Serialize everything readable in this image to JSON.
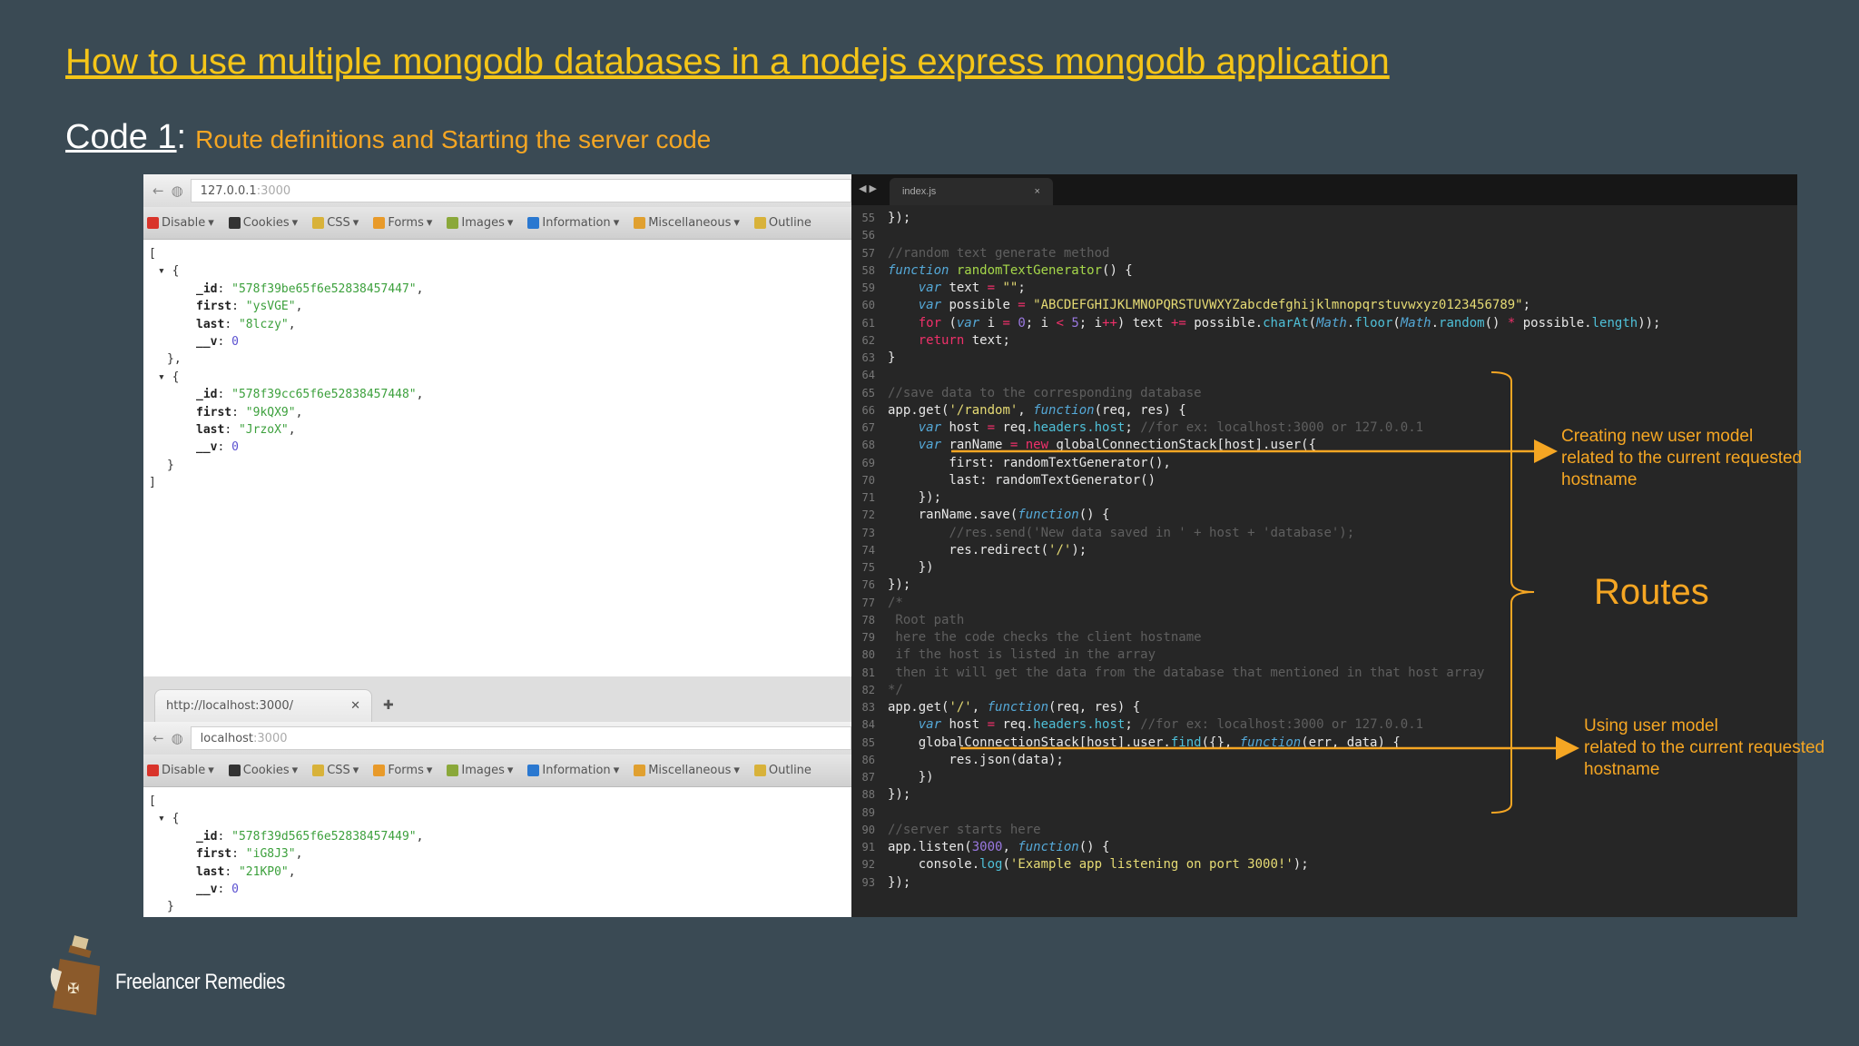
{
  "title": "How to use multiple mongodb databases in a nodejs express mongodb application",
  "subtitle": {
    "label": "Code 1",
    "colon": ":",
    "description": "Route definitions and Starting the server code"
  },
  "toolbar": [
    "Disable",
    "Cookies",
    "CSS",
    "Forms",
    "Images",
    "Information",
    "Miscellaneous",
    "Outline"
  ],
  "toolbar_colors": [
    "#d9342b",
    "#333333",
    "#d8b23a",
    "#e89a2a",
    "#8aa83a",
    "#2a78d0",
    "#e0a030",
    "#d8b23a"
  ],
  "browser1": {
    "host": "127.0.0.1",
    "port": ":3000",
    "records": [
      {
        "_id": "\"578f39be65f6e52838457447\"",
        "first": "\"ysVGE\"",
        "last": "\"8lczy\"",
        "__v": "0"
      },
      {
        "_id": "\"578f39cc65f6e52838457448\"",
        "first": "\"9kQX9\"",
        "last": "\"JrzoX\"",
        "__v": "0"
      }
    ]
  },
  "browser2": {
    "tab": "http://localhost:3000/",
    "host": "localhost",
    "port": ":3000",
    "records": [
      {
        "_id": "\"578f39d565f6e52838457449\"",
        "first": "\"iG8J3\"",
        "last": "\"21KP0\"",
        "__v": "0"
      }
    ]
  },
  "editor": {
    "tab": "index.js",
    "close": "×",
    "lines": [
      [
        55,
        [
          [
            "p",
            "});"
          ]
        ]
      ],
      [
        56,
        []
      ],
      [
        57,
        [
          [
            "c",
            "//random text generate method"
          ]
        ]
      ],
      [
        58,
        [
          [
            "k",
            "function "
          ],
          [
            "f",
            "randomTextGenerator"
          ],
          [
            "p",
            "() {"
          ]
        ]
      ],
      [
        59,
        [
          [
            "p",
            "    "
          ],
          [
            "k",
            "var "
          ],
          [
            "p",
            "text "
          ],
          [
            "r",
            "="
          ],
          [
            "s",
            " \"\""
          ],
          [
            "p",
            ";"
          ]
        ]
      ],
      [
        60,
        [
          [
            "p",
            "    "
          ],
          [
            "k",
            "var "
          ],
          [
            "p",
            "possible "
          ],
          [
            "r",
            "="
          ],
          [
            "s",
            " \"ABCDEFGHIJKLMNOPQRSTUVWXYZabcdefghijklmnopqrstuvwxyz0123456789\""
          ],
          [
            "p",
            ";"
          ]
        ]
      ],
      [
        61,
        [
          [
            "p",
            "    "
          ],
          [
            "r",
            "for"
          ],
          [
            "p",
            " ("
          ],
          [
            "k",
            "var "
          ],
          [
            "p",
            "i "
          ],
          [
            "r",
            "="
          ],
          [
            "n",
            " 0"
          ],
          [
            "p",
            "; i "
          ],
          [
            "r",
            "<"
          ],
          [
            "n",
            " 5"
          ],
          [
            "p",
            "; i"
          ],
          [
            "r",
            "++"
          ],
          [
            "p",
            ") text "
          ],
          [
            "r",
            "+="
          ],
          [
            "p",
            " possible."
          ],
          [
            "m",
            "charAt"
          ],
          [
            "p",
            "("
          ],
          [
            "k",
            "Math"
          ],
          [
            "p",
            "."
          ],
          [
            "m",
            "floor"
          ],
          [
            "p",
            "("
          ],
          [
            "k",
            "Math"
          ],
          [
            "p",
            "."
          ],
          [
            "m",
            "random"
          ],
          [
            "p",
            "() "
          ],
          [
            "r",
            "*"
          ],
          [
            "p",
            " possible."
          ],
          [
            "m",
            "length"
          ],
          [
            "p",
            "));"
          ]
        ]
      ],
      [
        62,
        [
          [
            "p",
            "    "
          ],
          [
            "r",
            "return"
          ],
          [
            "p",
            " text;"
          ]
        ]
      ],
      [
        63,
        [
          [
            "p",
            "}"
          ]
        ]
      ],
      [
        64,
        []
      ],
      [
        65,
        [
          [
            "c",
            "//save data to the corresponding database"
          ]
        ]
      ],
      [
        66,
        [
          [
            "p",
            "app.get("
          ],
          [
            "s",
            "'/random'"
          ],
          [
            "p",
            ", "
          ],
          [
            "k",
            "function"
          ],
          [
            "p",
            "(req, res) {"
          ]
        ]
      ],
      [
        67,
        [
          [
            "p",
            "    "
          ],
          [
            "k",
            "var "
          ],
          [
            "p",
            "host "
          ],
          [
            "r",
            "="
          ],
          [
            "p",
            " req."
          ],
          [
            "m",
            "headers.host"
          ],
          [
            "p",
            "; "
          ],
          [
            "c",
            "//for ex: localhost:3000 or 127.0.0.1"
          ]
        ]
      ],
      [
        68,
        [
          [
            "p",
            "    "
          ],
          [
            "k",
            "var "
          ],
          [
            "p",
            "ranName "
          ],
          [
            "r",
            "= new"
          ],
          [
            "p",
            " globalConnectionStack[host].user({"
          ]
        ]
      ],
      [
        69,
        [
          [
            "p",
            "        first: randomTextGenerator(),"
          ]
        ]
      ],
      [
        70,
        [
          [
            "p",
            "        last: randomTextGenerator()"
          ]
        ]
      ],
      [
        71,
        [
          [
            "p",
            "    });"
          ]
        ]
      ],
      [
        72,
        [
          [
            "p",
            "    ranName.save("
          ],
          [
            "k",
            "function"
          ],
          [
            "p",
            "() {"
          ]
        ]
      ],
      [
        73,
        [
          [
            "p",
            "        "
          ],
          [
            "c",
            "//res.send('New data saved in ' + host + 'database');"
          ]
        ]
      ],
      [
        74,
        [
          [
            "p",
            "        res.redirect("
          ],
          [
            "s",
            "'/'"
          ],
          [
            "p",
            ");"
          ]
        ]
      ],
      [
        75,
        [
          [
            "p",
            "    })"
          ]
        ]
      ],
      [
        76,
        [
          [
            "p",
            "});"
          ]
        ]
      ],
      [
        77,
        [
          [
            "c",
            "/*"
          ]
        ]
      ],
      [
        78,
        [
          [
            "c",
            " Root path"
          ]
        ]
      ],
      [
        79,
        [
          [
            "c",
            " here the code checks the client hostname"
          ]
        ]
      ],
      [
        80,
        [
          [
            "c",
            " if the host is listed in the array"
          ]
        ]
      ],
      [
        81,
        [
          [
            "c",
            " then it will get the data from the database that mentioned in that host array"
          ]
        ]
      ],
      [
        82,
        [
          [
            "c",
            "*/"
          ]
        ]
      ],
      [
        83,
        [
          [
            "p",
            "app.get("
          ],
          [
            "s",
            "'/'"
          ],
          [
            "p",
            ", "
          ],
          [
            "k",
            "function"
          ],
          [
            "p",
            "(req, res) {"
          ]
        ]
      ],
      [
        84,
        [
          [
            "p",
            "    "
          ],
          [
            "k",
            "var "
          ],
          [
            "p",
            "host "
          ],
          [
            "r",
            "="
          ],
          [
            "p",
            " req."
          ],
          [
            "m",
            "headers.host"
          ],
          [
            "p",
            "; "
          ],
          [
            "c",
            "//for ex: localhost:3000 or 127.0.0.1"
          ]
        ]
      ],
      [
        85,
        [
          [
            "p",
            "    globalConnectionStack[host].user."
          ],
          [
            "m",
            "find"
          ],
          [
            "p",
            "({}, "
          ],
          [
            "k",
            "function"
          ],
          [
            "p",
            "(err, data) {"
          ]
        ]
      ],
      [
        86,
        [
          [
            "p",
            "        res.json(data);"
          ]
        ]
      ],
      [
        87,
        [
          [
            "p",
            "    })"
          ]
        ]
      ],
      [
        88,
        [
          [
            "p",
            "});"
          ]
        ]
      ],
      [
        89,
        []
      ],
      [
        90,
        [
          [
            "c",
            "//server starts here"
          ]
        ]
      ],
      [
        91,
        [
          [
            "p",
            "app.listen("
          ],
          [
            "n",
            "3000"
          ],
          [
            "p",
            ", "
          ],
          [
            "k",
            "function"
          ],
          [
            "p",
            "() {"
          ]
        ]
      ],
      [
        92,
        [
          [
            "p",
            "    console."
          ],
          [
            "m",
            "log"
          ],
          [
            "p",
            "("
          ],
          [
            "s",
            "'Example app listening on port 3000!'"
          ],
          [
            "p",
            ");"
          ]
        ]
      ],
      [
        93,
        [
          [
            "p",
            "});"
          ]
        ]
      ]
    ]
  },
  "annotations": {
    "create": [
      "Creating new user model",
      "related to the current requested",
      "hostname"
    ],
    "use": [
      "Using user model",
      "related to the current requested",
      "hostname"
    ],
    "routes": "Routes"
  },
  "brand": "Freelancer Remedies",
  "colors": {
    "background": "#3a4a54",
    "accent": "#f5a623",
    "title": "#f5c518"
  }
}
